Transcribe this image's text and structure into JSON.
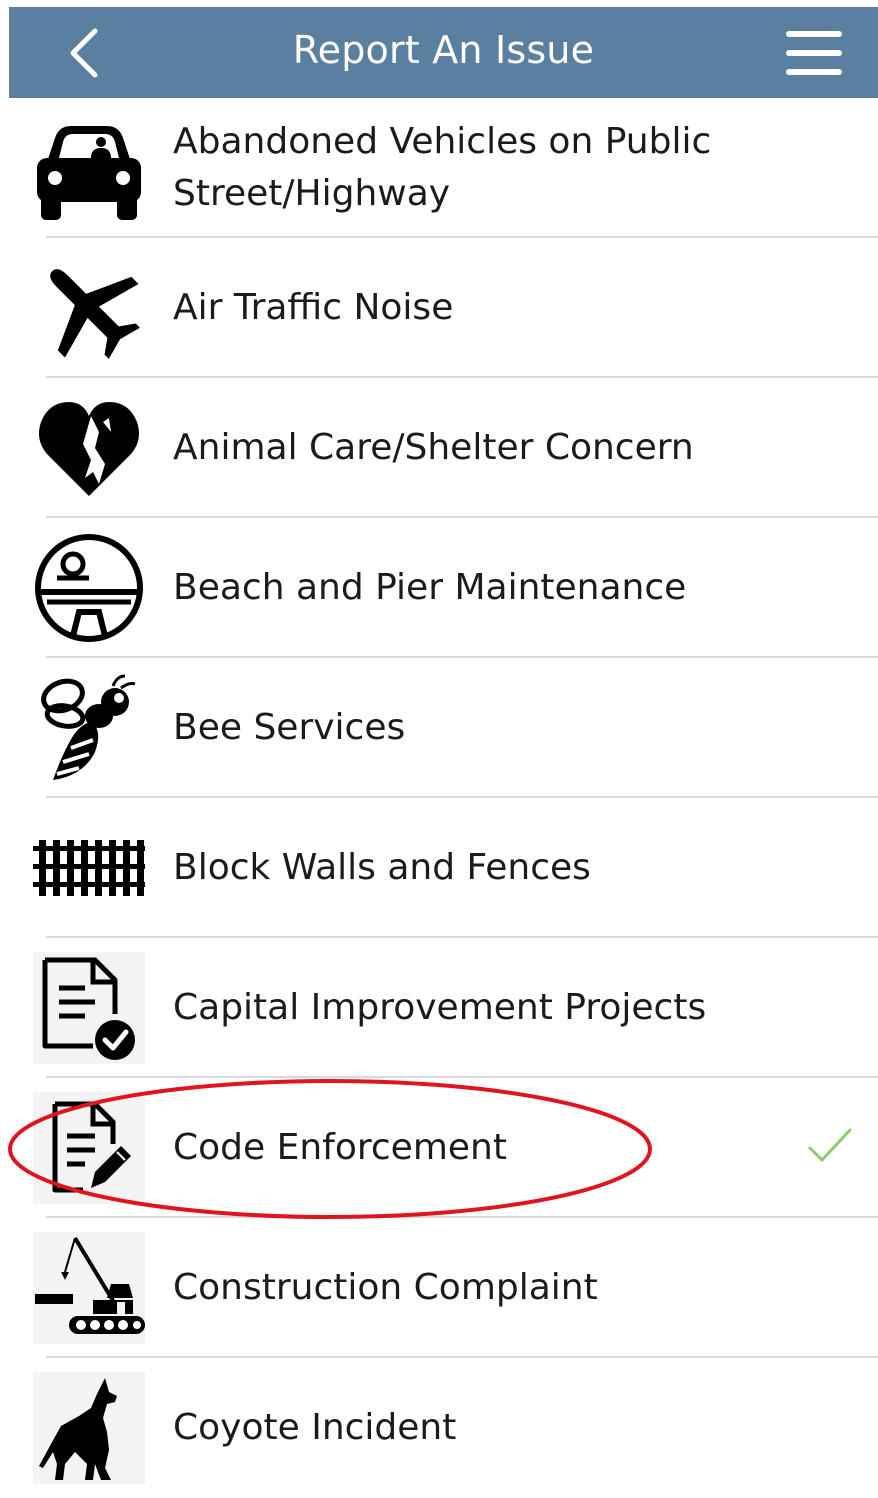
{
  "header": {
    "title": "Report An Issue",
    "back_icon": "chevron-left-icon",
    "menu_icon": "hamburger-menu-icon",
    "background": "#5a7f9f"
  },
  "items": [
    {
      "label": "Abandoned Vehicles on Public Street/Highway",
      "icon": "car-icon"
    },
    {
      "label": "Air Traffic Noise",
      "icon": "airplane-icon"
    },
    {
      "label": "Animal Care/Shelter Concern",
      "icon": "heart-animals-icon"
    },
    {
      "label": "Beach and Pier Maintenance",
      "icon": "beach-pier-icon"
    },
    {
      "label": "Bee Services",
      "icon": "bee-icon"
    },
    {
      "label": "Block Walls and Fences",
      "icon": "fence-icon"
    },
    {
      "label": "Capital Improvement Projects",
      "icon": "document-check-icon"
    },
    {
      "label": "Code Enforcement",
      "icon": "document-edit-icon",
      "selected": true
    },
    {
      "label": "Construction Complaint",
      "icon": "crane-icon"
    },
    {
      "label": "Coyote Incident",
      "icon": "coyote-icon"
    }
  ],
  "colors": {
    "selected_check": "#8ccc6c",
    "highlight_circle": "#e0141e"
  }
}
